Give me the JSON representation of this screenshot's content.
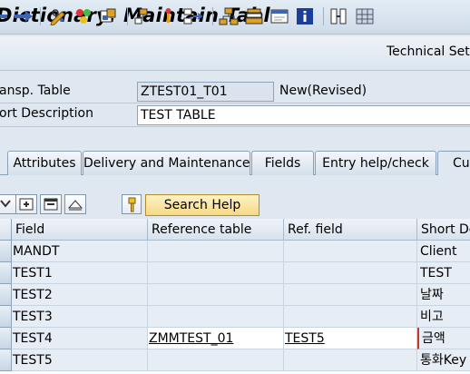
{
  "window": {
    "title": "Dictionary: Maintain Table"
  },
  "toolbar": {
    "icons": [
      "back-arrow-icon",
      "forward-arrow-icon",
      "pencil-glasses-icon",
      "activate-icon",
      "object-list-icon",
      "hierarchy-icon",
      "where-used-icon",
      "navigation-icon",
      "tree-icon",
      "stack-icon",
      "display-icon",
      "info-icon",
      "columns-icon",
      "grid-icon"
    ],
    "technical_settings_label": "Technical Setti"
  },
  "header": {
    "transp_table_label": "ansp. Table",
    "transp_table_value": "ZTEST01_T01",
    "status": "New(Revised)",
    "short_description_label": "ort Description",
    "short_description_value": "TEST TABLE"
  },
  "tabs": [
    {
      "label": "Attributes"
    },
    {
      "label": "Delivery and Maintenance"
    },
    {
      "label": "Fields"
    },
    {
      "label": "Entry help/check"
    },
    {
      "label": "Cur"
    }
  ],
  "grid_toolbar": {
    "icons": [
      "sort-icon",
      "insert-row-icon",
      "delete-row-icon",
      "move-up-icon",
      "key-icon"
    ],
    "search_help_label": "Search Help"
  },
  "table": {
    "columns": [
      "Field",
      "Reference table",
      "Ref. field",
      "Short De"
    ],
    "rows": [
      {
        "field": "MANDT",
        "ref_table": "",
        "ref_field": "",
        "short": "Client"
      },
      {
        "field": "TEST1",
        "ref_table": "",
        "ref_field": "",
        "short": "TEST"
      },
      {
        "field": "TEST2",
        "ref_table": "",
        "ref_field": "",
        "short": "날짜"
      },
      {
        "field": "TEST3",
        "ref_table": "",
        "ref_field": "",
        "short": "비고"
      },
      {
        "field": "TEST4",
        "ref_table": "ZMMTEST_01",
        "ref_field": "TEST5",
        "short": "금액"
      },
      {
        "field": "TEST5",
        "ref_table": "",
        "ref_field": "",
        "short": "통화Key"
      }
    ]
  },
  "colors": {
    "background": "#dfe8f1",
    "search_help_button": "#f5d983",
    "info_icon": "#1a3e9a"
  }
}
